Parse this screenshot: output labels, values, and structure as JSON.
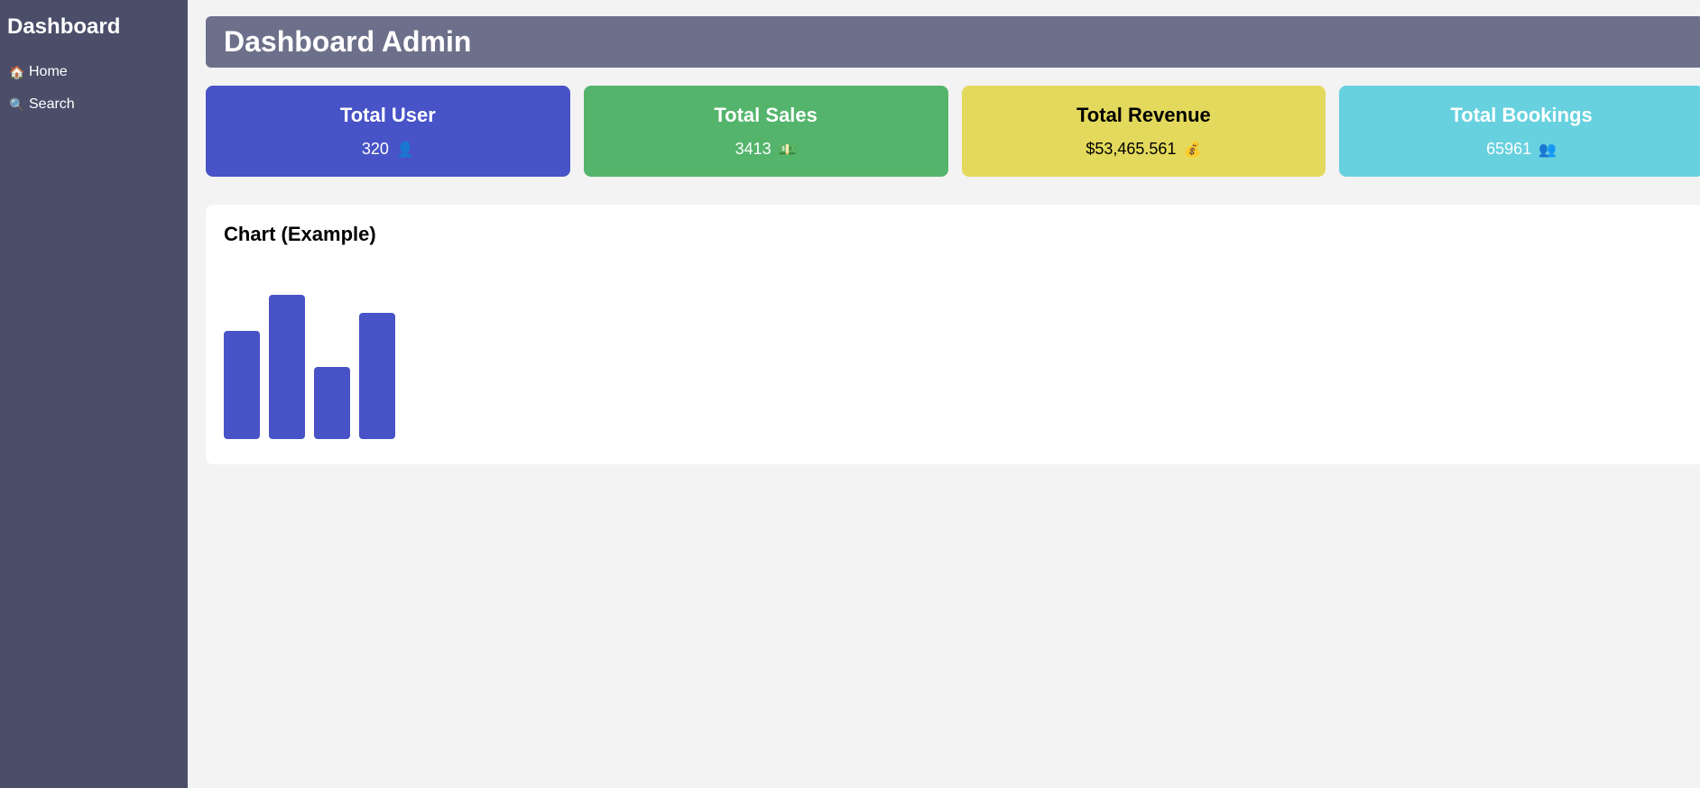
{
  "sidebar": {
    "title": "Dashboard",
    "items": [
      {
        "label": "Home",
        "icon": "house-icon",
        "glyph": "🏠"
      },
      {
        "label": "Search",
        "icon": "magnifier-icon",
        "glyph": "🔍"
      }
    ]
  },
  "header": {
    "title": "Dashboard Admin"
  },
  "cards": [
    {
      "title": "Total User",
      "value": "320",
      "icon": "user-icon",
      "glyph": "👤",
      "color": "#4753c6",
      "text_color": "#ffffff"
    },
    {
      "title": "Total Sales",
      "value": "3413",
      "icon": "money-icon",
      "glyph": "💵",
      "color": "#54b46c",
      "text_color": "#ffffff"
    },
    {
      "title": "Total Revenue",
      "value": "$53,465.561",
      "icon": "money-bag-icon",
      "glyph": "💰",
      "color": "#e3d95c",
      "text_color": "#000000"
    },
    {
      "title": "Total Bookings",
      "value": "65961",
      "icon": "users-icon",
      "glyph": "👥",
      "color": "#68d1df",
      "text_color": "#ffffff"
    }
  ],
  "chart": {
    "title": "Chart (Example)",
    "bar_color": "#4753c6"
  },
  "chart_data": {
    "type": "bar",
    "categories": [
      "",
      "",
      "",
      ""
    ],
    "values": [
      60,
      80,
      40,
      70
    ],
    "ylim": [
      0,
      100
    ],
    "title": "Chart (Example)",
    "xlabel": "",
    "ylabel": ""
  }
}
